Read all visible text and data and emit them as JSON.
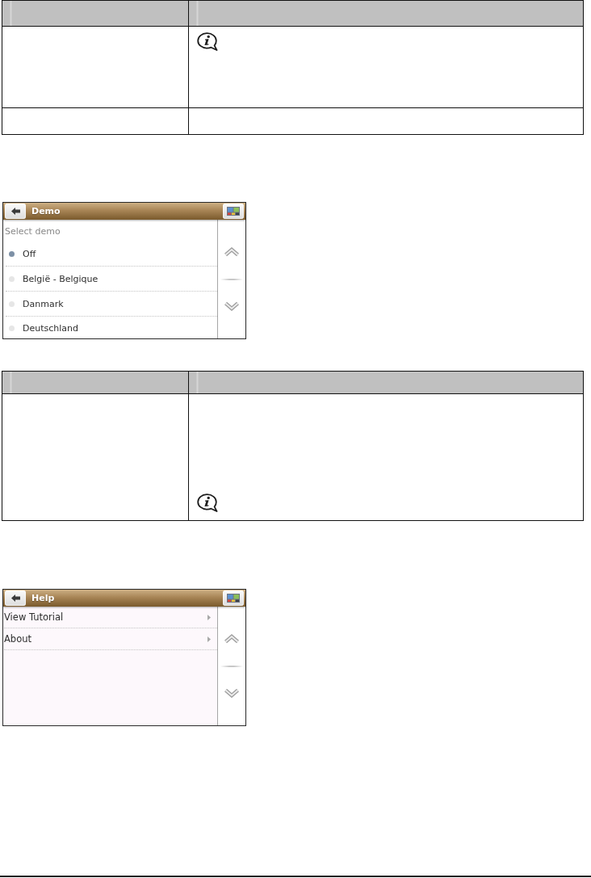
{
  "sections": [
    {
      "kind": "table",
      "rows": [
        {
          "kind": "note",
          "info_icon": true
        },
        {
          "kind": "note",
          "info_icon": false
        }
      ]
    },
    {
      "kind": "screen",
      "title": "Demo",
      "subtitle": "Select demo",
      "items": [
        {
          "kind": "radio",
          "label": "Off",
          "selected": true
        },
        {
          "kind": "radio",
          "label": "België - Belgique",
          "selected": false
        },
        {
          "kind": "radio",
          "label": "Danmark",
          "selected": false
        },
        {
          "kind": "radio",
          "label": "Deutschland",
          "selected": false
        }
      ]
    },
    {
      "kind": "table",
      "rows": [
        {
          "kind": "endnote",
          "info_icon": true
        }
      ]
    },
    {
      "kind": "screen",
      "title": "Help",
      "items": [
        {
          "kind": "link",
          "label": "View Tutorial"
        },
        {
          "kind": "link",
          "label": "About"
        }
      ]
    }
  ]
}
